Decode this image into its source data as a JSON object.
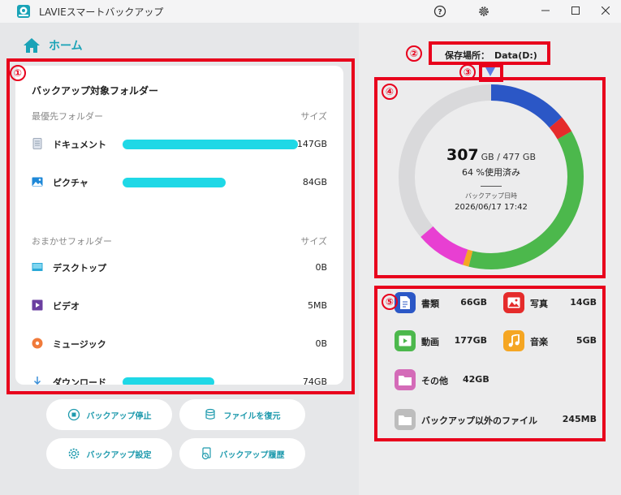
{
  "app": {
    "title": "LAVIEスマートバックアップ"
  },
  "nav": {
    "home": "ホーム"
  },
  "folders": {
    "title": "バックアップ対象フォルダー",
    "priority": {
      "heading": "最優先フォルダー",
      "size_heading": "サイズ",
      "items": [
        {
          "name": "ドキュメント",
          "size": "147GB",
          "bar": 1.0
        },
        {
          "name": "ピクチャ",
          "size": "84GB",
          "bar": 0.57
        }
      ]
    },
    "auto": {
      "heading": "おまかせフォルダー",
      "size_heading": "サイズ",
      "items": [
        {
          "name": "デスクトップ",
          "size": "0B",
          "bar": 0
        },
        {
          "name": "ビデオ",
          "size": "5MB",
          "bar": 0
        },
        {
          "name": "ミュージック",
          "size": "0B",
          "bar": 0
        },
        {
          "name": "ダウンロード",
          "size": "74GB",
          "bar": 0.5
        }
      ]
    }
  },
  "actions": {
    "stop": "バックアップ停止",
    "restore": "ファイルを復元",
    "settings": "バックアップ設定",
    "history": "バックアップ履歴"
  },
  "storage": {
    "label": "保存場所：",
    "drive": "Data(D:)",
    "used": "307",
    "total_text": "GB / 477 GB",
    "percent_text": "64 %使用済み",
    "date_label": "バックアップ日時",
    "date": "2026/06/17 17:42"
  },
  "categories": [
    {
      "name": "書類",
      "size": "66GB",
      "color": "#2b57c6"
    },
    {
      "name": "写真",
      "size": "14GB",
      "color": "#e52b2b"
    },
    {
      "name": "動画",
      "size": "177GB",
      "color": "#4cb84c"
    },
    {
      "name": "音楽",
      "size": "5GB",
      "color": "#f5a623"
    },
    {
      "name": "その他",
      "size": "42GB",
      "color": "#e83fd2"
    },
    {
      "name": "バックアップ以外のファイル",
      "size": "245MB",
      "color": "#c8c8c8"
    }
  ],
  "annotations": [
    "①",
    "②",
    "③",
    "④",
    "⑤"
  ],
  "colors": {
    "accent": "#1aa3b7",
    "bar": "#1fd8e6",
    "annotation": "#e8001c"
  }
}
